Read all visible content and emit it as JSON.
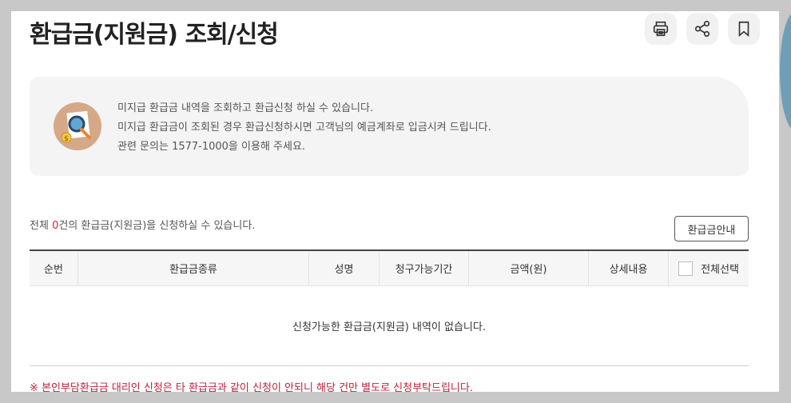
{
  "page": {
    "title": "환급금(지원금) 조회/신청"
  },
  "toolbar": [
    {
      "name": "print-button",
      "icon": "printer-icon"
    },
    {
      "name": "share-button",
      "icon": "share-icon"
    },
    {
      "name": "bookmark-button",
      "icon": "bookmark-icon"
    }
  ],
  "info": {
    "icon": "search-money-icon",
    "lines": [
      "미지급 환급금 내역을 조회하고 환급신청 하실 수 있습니다.",
      "미지급 환급금이 조회된 경우 환급신청하시면 고객님의 예금계좌로 입금시켜 드립니다.",
      "관련 문의는 1577-1000을 이용해 주세요."
    ]
  },
  "summary": {
    "prefix": "전체 ",
    "count": "0",
    "suffix": "건의 환급금(지원금)을 신청하실 수 있습니다."
  },
  "guide_button": "환급금안내",
  "table": {
    "columns": [
      "순번",
      "환급금종류",
      "성명",
      "청구가능기간",
      "금액(원)",
      "상세내용",
      "전체선택"
    ],
    "empty_message": "신청가능한 환급금(지원금) 내역이 없습니다."
  },
  "notice": "※ 본인부담환급금 대리인 신청은 타 환급금과 같이 신청이 안되니 해당 건만 별도로 신청부탁드립니다.",
  "colors": {
    "accent_red": "#d22233",
    "icon_bg": "#d5a987"
  }
}
